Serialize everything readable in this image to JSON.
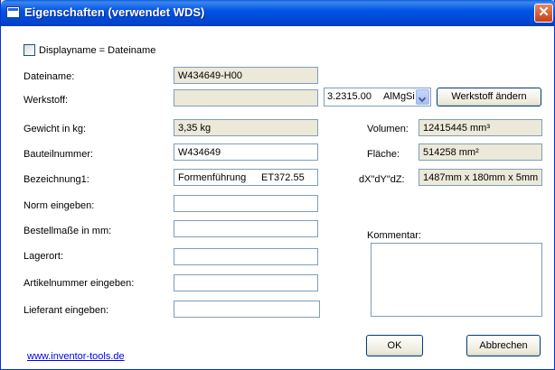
{
  "window": {
    "title": "Eigenschaften (verwendet WDS)",
    "close_glyph": "✕"
  },
  "checkbox": {
    "label": "Displayname = Dateiname",
    "checked": false
  },
  "fields": {
    "dateiname": {
      "label": "Dateiname:",
      "value": "W434649-H00"
    },
    "werkstoff": {
      "label": "Werkstoff:",
      "value": "",
      "combo_code": "3.2315.00",
      "combo_name": "AlMgSi",
      "button": "Werkstoff ändern"
    },
    "gewicht": {
      "label": "Gewicht in kg:",
      "value": "3,35 kg"
    },
    "bauteilnummer": {
      "label": "Bauteilnummer:",
      "value": "W434649"
    },
    "bezeichnung1": {
      "label": "Bezeichnung1:",
      "value_a": "Formenführung",
      "value_b": "ET372.55"
    },
    "norm": {
      "label": "Norm eingeben:",
      "value": ""
    },
    "bestellmasse": {
      "label": "Bestellmaße  in mm:",
      "value": ""
    },
    "lagerort": {
      "label": "Lagerort:",
      "value": ""
    },
    "artikelnummer": {
      "label": "Artikelnummer eingeben:",
      "value": ""
    },
    "lieferant": {
      "label": "Lieferant eingeben:",
      "value": ""
    }
  },
  "info": {
    "volumen": {
      "label": "Volumen:",
      "value": "12415445 mm³"
    },
    "flaeche": {
      "label": "Fläche:",
      "value": "514258 mm²"
    },
    "dims": {
      "label": "dX\"dY\"dZ:",
      "value": "1487mm x 180mm x 5mm"
    }
  },
  "kommentar": {
    "label": "Kommentar:",
    "value": ""
  },
  "buttons": {
    "ok": "OK",
    "cancel": "Abbrechen"
  },
  "link": "www.inventor-tools.de",
  "colors": {
    "titlebar": "#0055e5",
    "dialog_bg": "#ffffff",
    "readonly_bg": "#ece9d8",
    "field_border": "#7f9db9",
    "link": "#0000ee"
  }
}
